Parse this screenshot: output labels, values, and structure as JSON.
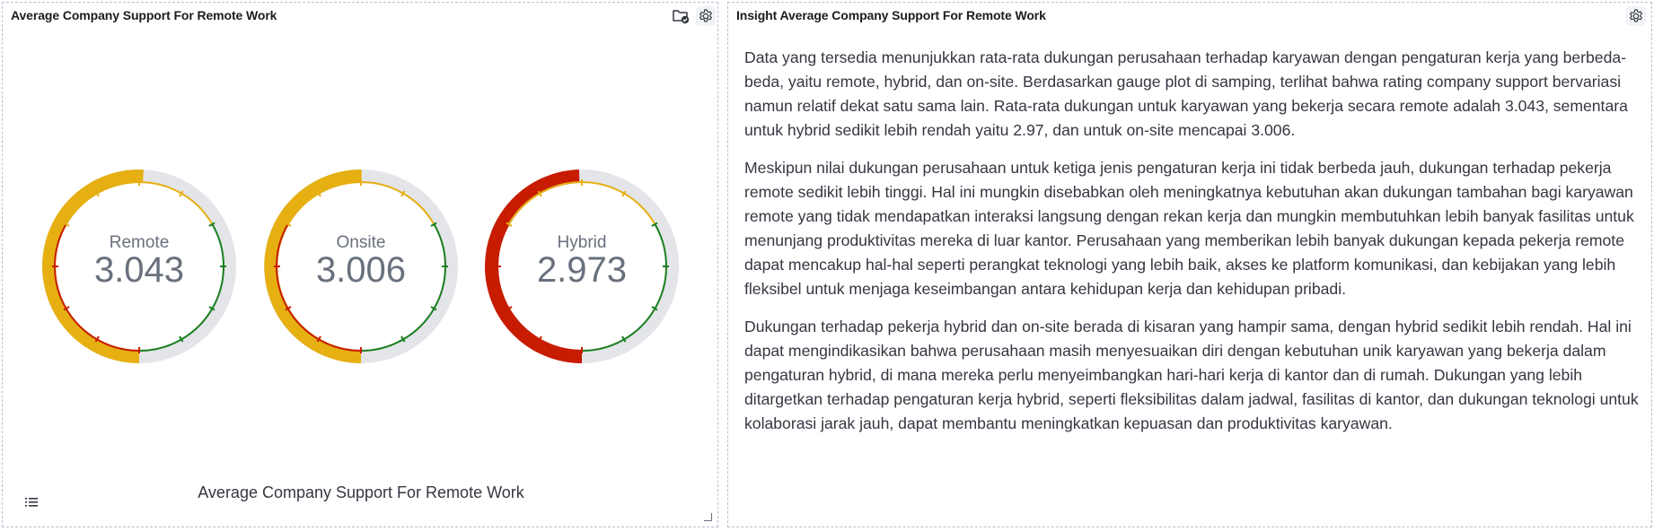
{
  "left_panel": {
    "title": "Average Company Support For Remote Work",
    "caption": "Average Company Support For Remote Work",
    "icons": [
      "folder-check-icon",
      "gear-icon",
      "legend-list-icon"
    ]
  },
  "right_panel": {
    "title": "Insight Average Company Support For Remote Work",
    "icons": [
      "gear-icon"
    ],
    "paragraphs": [
      "Data yang tersedia menunjukkan rata-rata dukungan perusahaan terhadap karyawan dengan pengaturan kerja yang berbeda-beda, yaitu remote, hybrid, dan on-site. Berdasarkan gauge plot di samping, terlihat bahwa rating company support bervariasi namun relatif dekat satu sama lain. Rata-rata dukungan untuk karyawan yang bekerja secara remote adalah 3.043, sementara untuk hybrid sedikit lebih rendah yaitu 2.97, dan untuk on-site mencapai 3.006.",
      "Meskipun nilai dukungan perusahaan untuk ketiga jenis pengaturan kerja ini tidak berbeda jauh, dukungan terhadap pekerja remote sedikit lebih tinggi. Hal ini mungkin disebabkan oleh meningkatnya kebutuhan akan dukungan tambahan bagi karyawan remote yang tidak mendapatkan interaksi langsung dengan rekan kerja dan mungkin membutuhkan lebih banyak fasilitas untuk menunjang produktivitas mereka di luar kantor. Perusahaan yang memberikan lebih banyak dukungan kepada pekerja remote dapat mencakup hal-hal seperti perangkat teknologi yang lebih baik, akses ke platform komunikasi, dan kebijakan yang lebih fleksibel untuk menjaga keseimbangan antara kehidupan kerja dan kehidupan pribadi.",
      "Dukungan terhadap pekerja hybrid dan on-site berada di kisaran yang hampir sama, dengan hybrid sedikit lebih rendah. Hal ini dapat mengindikasikan bahwa perusahaan masih menyesuaikan diri dengan kebutuhan unik karyawan yang bekerja dalam pengaturan hybrid, di mana mereka perlu menyeimbangkan hari-hari kerja di kantor dan di rumah. Dukungan yang lebih ditargetkan terhadap pengaturan kerja hybrid, seperti fleksibilitas dalam jadwal, fasilitas di kantor, dan dukungan teknologi untuk kolaborasi jarak jauh, dapat membantu meningkatkan kepuasan dan produktivitas karyawan."
    ]
  },
  "chart_data": {
    "type": "gauge",
    "title": "Average Company Support For Remote Work",
    "range": [
      0,
      6
    ],
    "series": [
      {
        "name": "Remote",
        "value": 3.043,
        "display": "3.043",
        "color": "#e6b012"
      },
      {
        "name": "Onsite",
        "value": 3.006,
        "display": "3.006",
        "color": "#e6b012"
      },
      {
        "name": "Hybrid",
        "value": 2.973,
        "display": "2.973",
        "color": "#c71c00"
      }
    ],
    "bands": [
      {
        "from": 0,
        "to": 2,
        "color": "#c71c00"
      },
      {
        "from": 2,
        "to": 4,
        "color": "#e6b012"
      },
      {
        "from": 4,
        "to": 6,
        "color": "#1a7f1f"
      }
    ],
    "track_color": "#e3e5e9"
  }
}
